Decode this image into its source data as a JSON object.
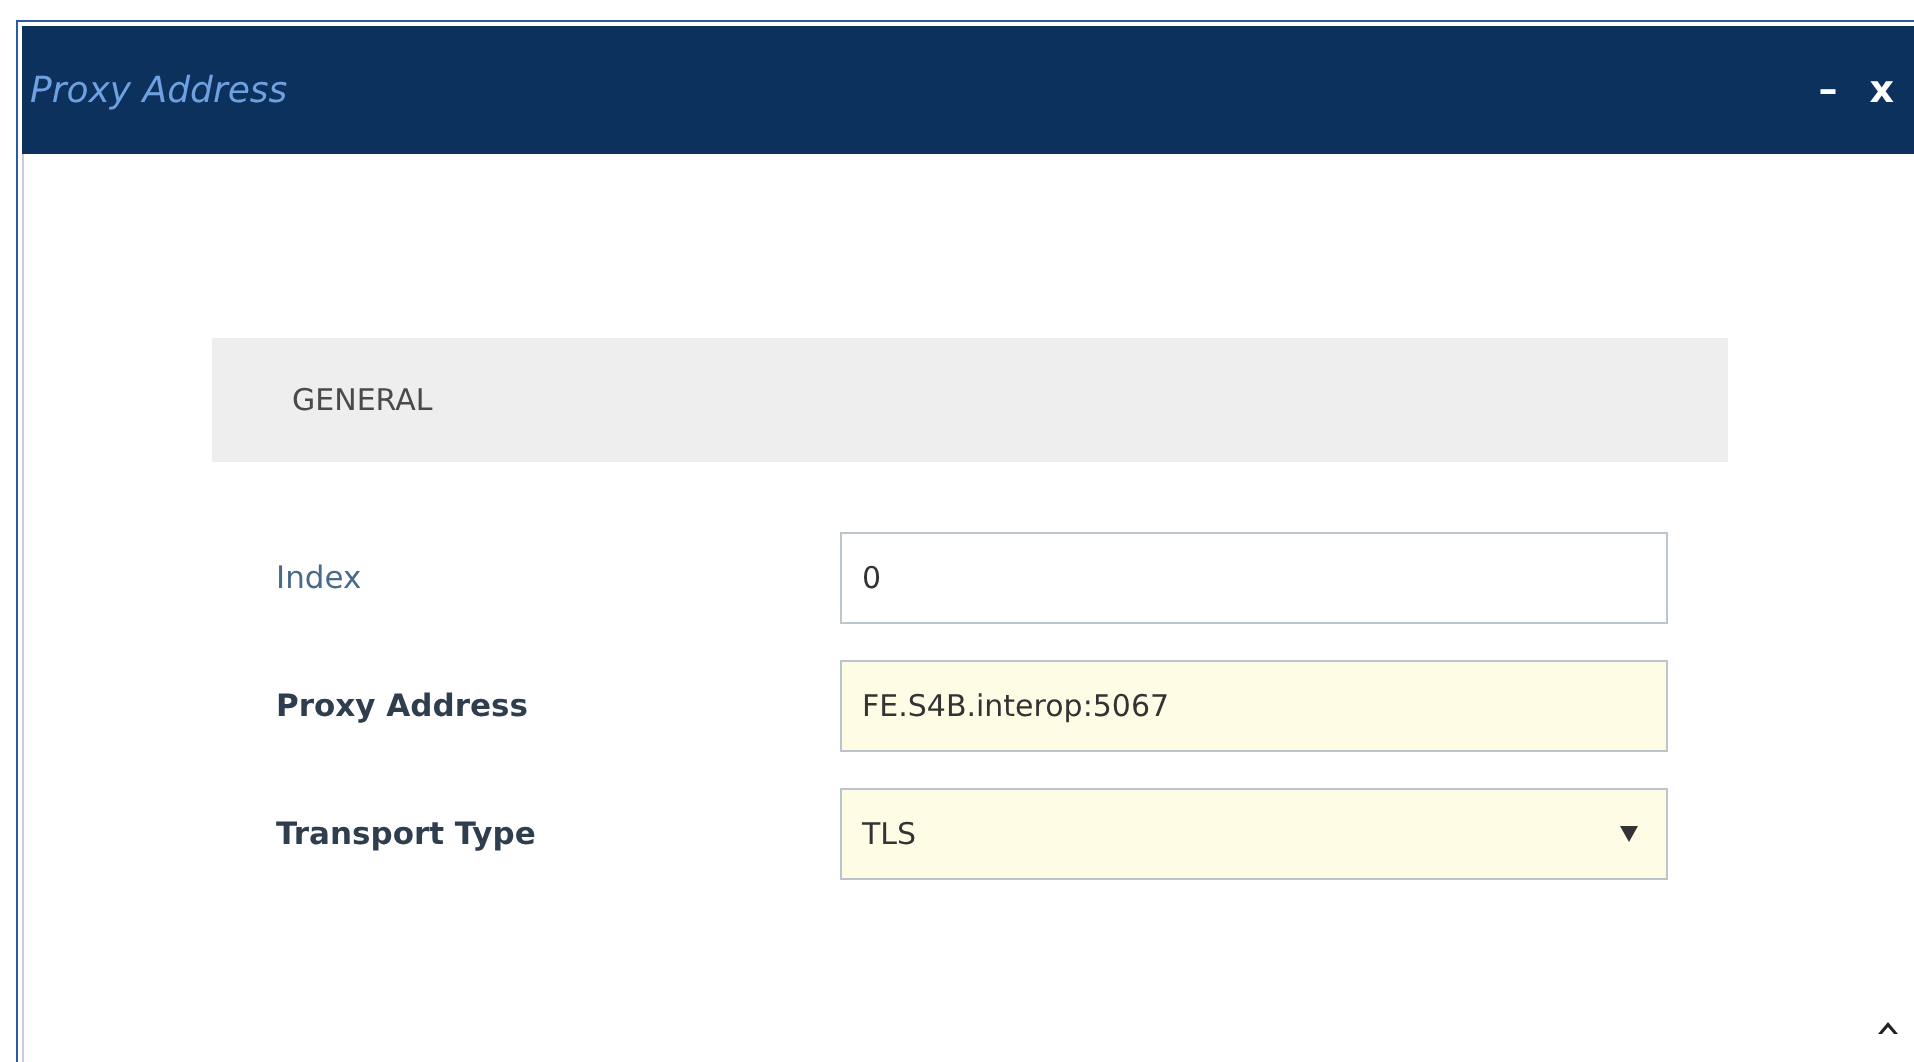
{
  "window": {
    "title": "Proxy Address",
    "controls": [
      "–",
      "x"
    ]
  },
  "section": {
    "title": "GENERAL"
  },
  "fields": [
    {
      "label": "Index",
      "kind": "text",
      "value": "0",
      "modified": false
    },
    {
      "label": "Proxy Address",
      "kind": "text",
      "value": "FE.S4B.interop:5067",
      "modified": true
    },
    {
      "label": "Transport Type",
      "kind": "select",
      "value": "TLS",
      "modified": true
    }
  ]
}
